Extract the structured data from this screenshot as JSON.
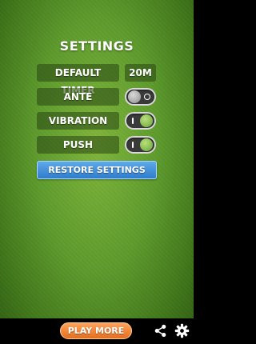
{
  "title": "SETTINGS",
  "settings": {
    "default_timer": {
      "label": "DEFAULT TIMER",
      "value": "20m"
    },
    "ante": {
      "label": "ANTE",
      "state": "off"
    },
    "vibration": {
      "label": "VIBRATION",
      "state": "on"
    },
    "push": {
      "label": "PUSH",
      "state": "on"
    }
  },
  "restore_label": "RESTORE SETTINGS",
  "bottom_bar": {
    "play_more_label": "PLAY MORE",
    "share_icon": "share-icon",
    "settings_icon": "gear-icon"
  },
  "colors": {
    "background": "#5d9a2c",
    "toggle_on": "#7fb53a",
    "restore_button": "#3d8ad6",
    "play_more_button": "#f7873a"
  }
}
